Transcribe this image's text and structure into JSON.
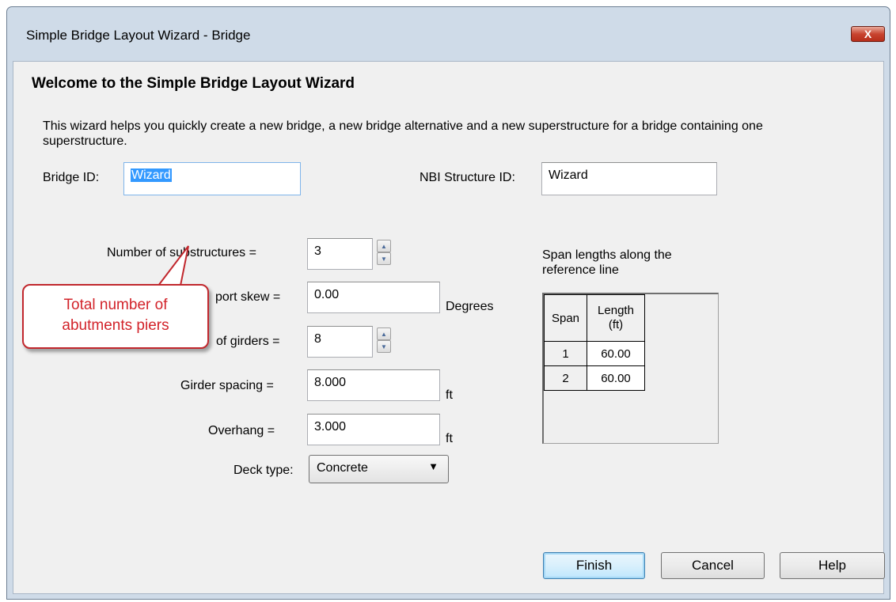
{
  "window": {
    "title": "Simple Bridge Layout Wizard - Bridge",
    "close_label": "X"
  },
  "heading": "Welcome to the Simple Bridge Layout Wizard",
  "description": "This wizard helps you quickly create a new bridge, a new bridge alternative and a new superstructure for a bridge containing one superstructure.",
  "bridge_id": {
    "label": "Bridge ID:",
    "value": "Wizard"
  },
  "nbi_id": {
    "label": "NBI Structure ID:",
    "value": "Wizard"
  },
  "form": {
    "num_substructures": {
      "label": "Number of substructures =",
      "value": "3"
    },
    "support_skew": {
      "label": "port skew =",
      "value": "0.00",
      "unit": "Degrees"
    },
    "num_girders": {
      "label": "of girders =",
      "value": "8"
    },
    "girder_spacing": {
      "label": "Girder spacing =",
      "value": "8.000",
      "unit": "ft"
    },
    "overhang": {
      "label": "Overhang =",
      "value": "3.000",
      "unit": "ft"
    },
    "deck_type": {
      "label": "Deck type:",
      "value": "Concrete"
    }
  },
  "span_table": {
    "caption": "Span lengths along the reference line",
    "headers": {
      "span": "Span",
      "length": "Length",
      "length_unit": "(ft)"
    },
    "rows": [
      {
        "span": "1",
        "length": "60.00"
      },
      {
        "span": "2",
        "length": "60.00"
      }
    ]
  },
  "callout": {
    "line1": "Total number of",
    "line2": "abutments piers"
  },
  "buttons": {
    "finish": "Finish",
    "cancel": "Cancel",
    "help": "Help"
  },
  "colors": {
    "callout_border": "#c1272d",
    "callout_text": "#d2232a",
    "selection": "#3399ff"
  }
}
